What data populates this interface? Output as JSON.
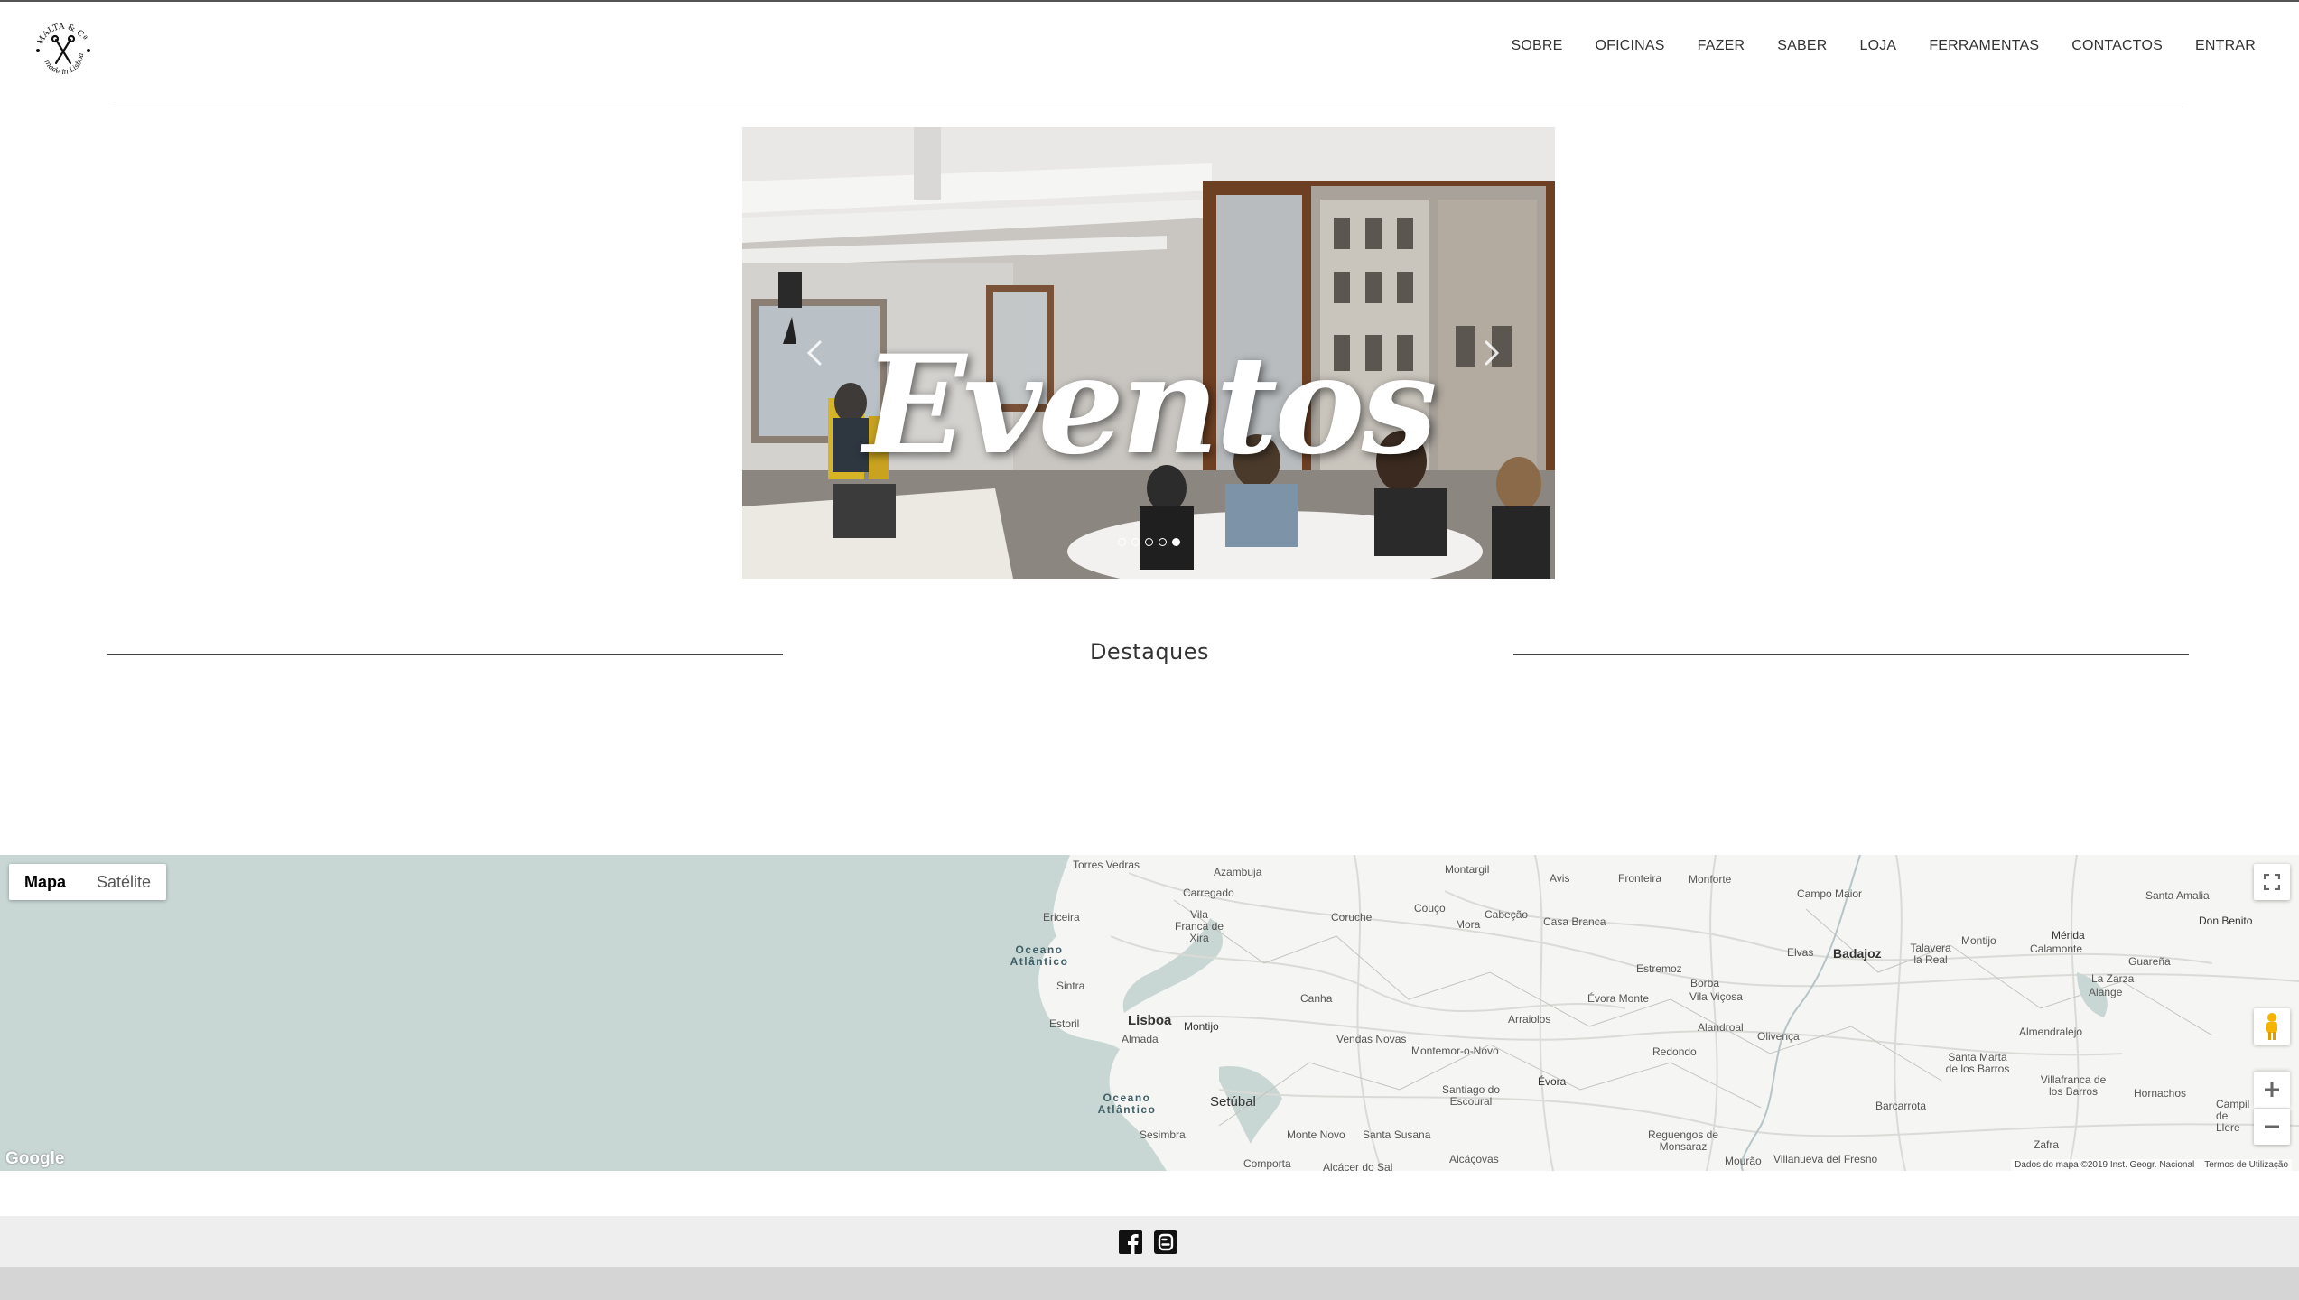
{
  "brand": {
    "logo_text_top": "MALTA & Cª",
    "logo_text_bottom": "made in Lisboa"
  },
  "nav": {
    "items": [
      "SOBRE",
      "OFICINAS",
      "FAZER",
      "SABER",
      "LOJA",
      "FERRAMENTAS",
      "CONTACTOS",
      "ENTRAR"
    ]
  },
  "hero": {
    "title": "Eventos",
    "slide_count": 5,
    "active_slide": 5
  },
  "section": {
    "title": "Destaques"
  },
  "map": {
    "type_options": [
      "Mapa",
      "Satélite"
    ],
    "selected_type": "Mapa",
    "places": {
      "torres_vedras": "Torres Vedras",
      "azambuja": "Azambuja",
      "montargil": "Montargil",
      "avis": "Avis",
      "fronteira": "Fronteira",
      "monforte": "Monforte",
      "campo_maior": "Campo Maior",
      "santa_amalia": "Santa Amalia",
      "don_benito": "Don Benito",
      "carregado": "Carregado",
      "ericeira": "Ericeira",
      "vila_franca": "Vila Franca de Xira",
      "coruche": "Coruche",
      "couco": "Couço",
      "mora": "Mora",
      "cabecao": "Cabeção",
      "casa_branca": "Casa Branca",
      "elvas": "Elvas",
      "badajoz": "Badajoz",
      "talavera": "Talavera la Real",
      "montijo_es": "Montijo",
      "merida": "Mérida",
      "calamonte": "Calamonte",
      "guarena": "Guareña",
      "oceano1": "Oceano Atlântico",
      "sintra": "Sintra",
      "estremoz": "Estremoz",
      "borba": "Borba",
      "vila_vicosa": "Vila Viçosa",
      "la_zarza": "La Zarza",
      "alange": "Alange",
      "estoril": "Estoril",
      "lisboa": "Lisboa",
      "montijo": "Montijo",
      "canha": "Canha",
      "arraiolos": "Arraiolos",
      "evora_monte": "Évora Monte",
      "alandroal": "Alandroal",
      "olivenca": "Olivença",
      "almendralejo": "Almendralejo",
      "almada": "Almada",
      "vendas_novas": "Vendas Novas",
      "montemor": "Montemor-o-Novo",
      "redondo": "Redondo",
      "santa_marta": "Santa Marta de los Barros",
      "villafranca": "Villafranca de los Barros",
      "hornachos": "Hornachos",
      "oceano2": "Oceano Atlântico",
      "setubal": "Setúbal",
      "santiago": "Santiago do Escoural",
      "evora": "Évora",
      "barcarrota": "Barcarrota",
      "campillo": "Campil de Llere",
      "sesimbra": "Sesimbra",
      "monte_novo": "Monte Novo",
      "santa_susana": "Santa Susana",
      "reguengos": "Reguengos de Monsaraz",
      "zafra": "Zafra",
      "comporta": "Comporta",
      "alcacer": "Alcácer do Sal",
      "alcacovas": "Alcáçovas",
      "mourao": "Mourão",
      "villanueva": "Villanueva del Fresno"
    },
    "google_logo": "Google",
    "attribution": "Dados do mapa ©2019 Inst. Geogr. Nacional",
    "terms": "Termos de Utilização"
  },
  "footer": {
    "social": [
      "facebook-icon",
      "blogger-icon"
    ]
  }
}
